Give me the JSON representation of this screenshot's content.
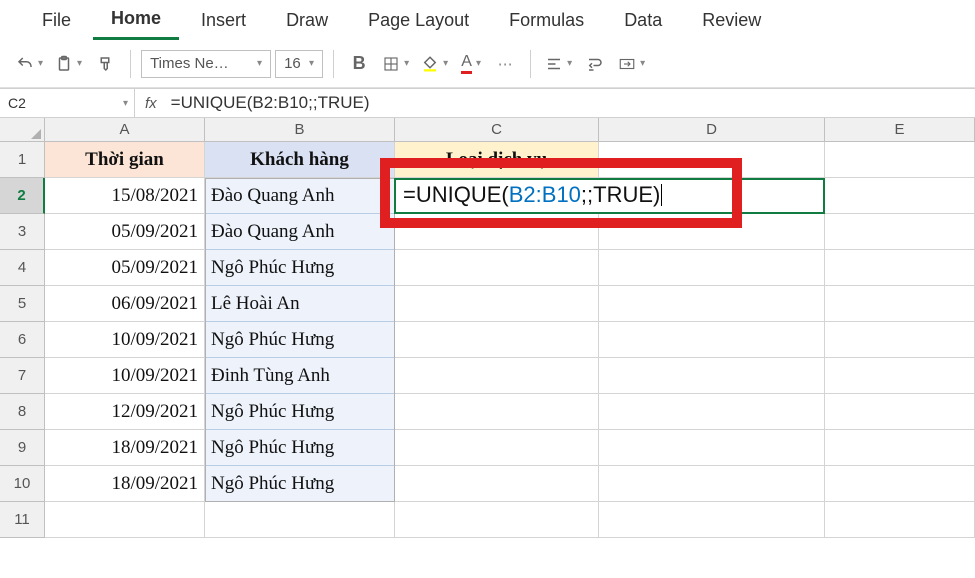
{
  "tabs": [
    "File",
    "Home",
    "Insert",
    "Draw",
    "Page Layout",
    "Formulas",
    "Data",
    "Review"
  ],
  "active_tab": "Home",
  "font_name": "Times Ne…",
  "font_size": "16",
  "name_box": "C2",
  "formula_bar": "=UNIQUE(B2:B10;;TRUE)",
  "columns": [
    "A",
    "B",
    "C",
    "D",
    "E"
  ],
  "row_headers": [
    "1",
    "2",
    "3",
    "4",
    "5",
    "6",
    "7",
    "8",
    "9",
    "10",
    "11"
  ],
  "headers": {
    "A": "Thời gian",
    "B": "Khách hàng",
    "C": "Loại dịch vụ"
  },
  "rows": [
    {
      "A": "15/08/2021",
      "B": "Đào Quang Anh"
    },
    {
      "A": "05/09/2021",
      "B": "Đào Quang Anh"
    },
    {
      "A": "05/09/2021",
      "B": "Ngô Phúc Hưng"
    },
    {
      "A": "06/09/2021",
      "B": "Lê Hoài An"
    },
    {
      "A": "10/09/2021",
      "B": "Ngô Phúc Hưng"
    },
    {
      "A": "10/09/2021",
      "B": "Đinh Tùng Anh"
    },
    {
      "A": "12/09/2021",
      "B": "Ngô Phúc Hưng"
    },
    {
      "A": "18/09/2021",
      "B": "Ngô Phúc Hưng"
    },
    {
      "A": "18/09/2021",
      "B": "Ngô Phúc Hưng"
    }
  ],
  "edit_cell": {
    "ref": "C2",
    "prefix": "=UNIQUE(",
    "range": "B2:B10",
    "suffix": ";;TRUE)"
  }
}
